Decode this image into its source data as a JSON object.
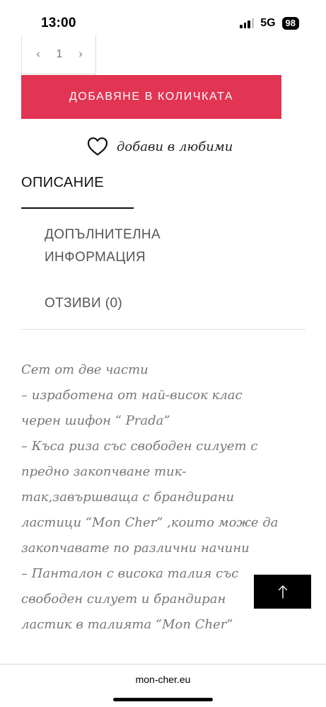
{
  "status_bar": {
    "time": "13:00",
    "network": "5G",
    "battery": "98"
  },
  "quantity": {
    "decrement_icon": "‹",
    "value": "1",
    "increment_icon": "›"
  },
  "add_to_cart": {
    "label": "ДОБАВЯНЕ В КОЛИЧКАТА",
    "color": "#e23453"
  },
  "wishlist": {
    "icon": "heart-outline-icon",
    "label": "добави в любими"
  },
  "tabs": [
    {
      "label": "ОПИСАНИЕ",
      "active": true
    },
    {
      "label": "ДОПЪЛНИТЕЛНА ИНФОРМАЦИЯ",
      "active": false
    },
    {
      "label": "ОТЗИВИ (0)",
      "active": false
    }
  ],
  "description": {
    "lines": [
      "Сет от две части",
      "– изработена от най-висок клас",
      "черен шифон “ Prada”",
      "– Къса риза със свободен силует с",
      "предно закопчване тик-",
      "так,завършваща с брандирани",
      "ластици “Mon Cher” ,които може да",
      "закопчавате по различни начини",
      "– Панталон с висока талия със",
      "свободен силует и брандиран",
      "ластик в талията “Mon Cher”"
    ]
  },
  "back_to_top": {
    "icon": "arrow-up-icon"
  },
  "browser": {
    "url": "mon-cher.eu"
  }
}
